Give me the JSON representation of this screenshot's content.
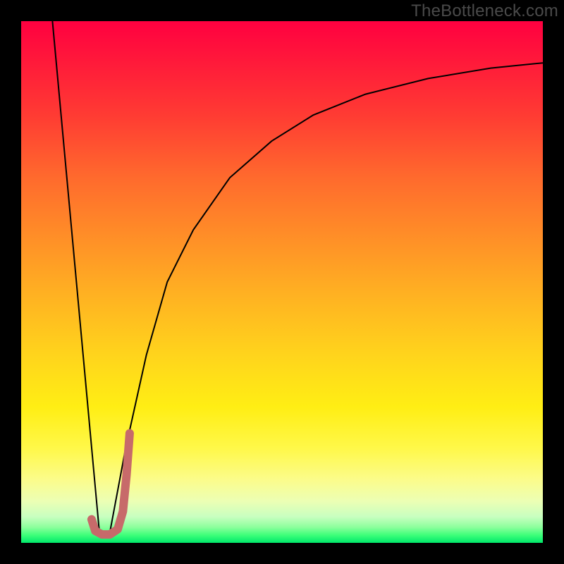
{
  "watermark": "TheBottleneck.com",
  "chart_data": {
    "type": "line",
    "title": "",
    "xlabel": "",
    "ylabel": "",
    "xlim": [
      0,
      100
    ],
    "ylim": [
      0,
      100
    ],
    "grid": false,
    "legend": false,
    "series": [
      {
        "name": "left-descending-line",
        "color": "#000000",
        "stroke_width": 2,
        "x": [
          6,
          15
        ],
        "values": [
          100,
          2
        ]
      },
      {
        "name": "right-rising-curve",
        "color": "#000000",
        "stroke_width": 2,
        "x": [
          17,
          20,
          24,
          28,
          33,
          40,
          48,
          56,
          66,
          78,
          90,
          100
        ],
        "values": [
          2,
          18,
          36,
          50,
          60,
          70,
          77,
          82,
          86,
          89,
          91,
          92
        ]
      },
      {
        "name": "j-mark",
        "color": "#c76a6a",
        "stroke_width": 12,
        "x": [
          13.5,
          14.2,
          15.5,
          17,
          18.5,
          19.5,
          20.2,
          20.8
        ],
        "values": [
          4.5,
          2.3,
          1.6,
          1.6,
          2.6,
          6,
          13,
          21
        ]
      }
    ],
    "background_gradient_stops": [
      {
        "pos": 0.0,
        "color": "#ff0040"
      },
      {
        "pos": 0.3,
        "color": "#ff6a2d"
      },
      {
        "pos": 0.64,
        "color": "#ffd41c"
      },
      {
        "pos": 0.88,
        "color": "#fbfc8c"
      },
      {
        "pos": 1.0,
        "color": "#00e86a"
      }
    ]
  }
}
